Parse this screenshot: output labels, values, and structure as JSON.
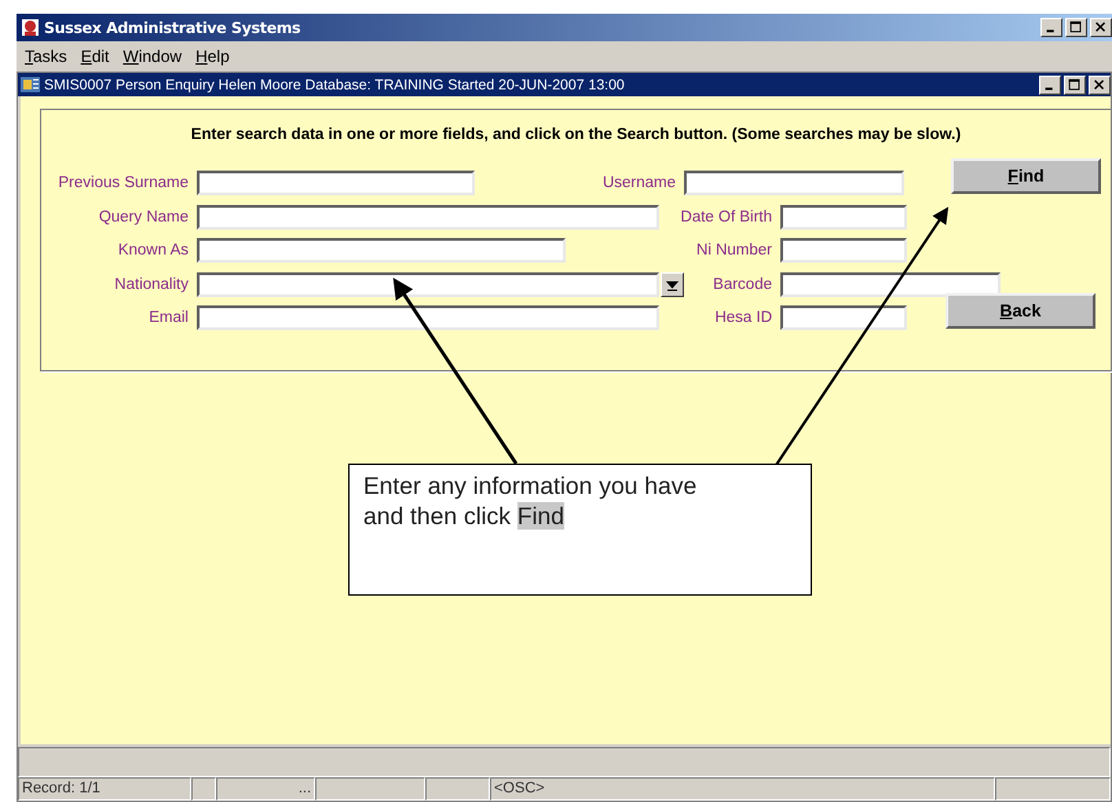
{
  "window": {
    "title": "Sussex Administrative Systems"
  },
  "menu": [
    "Tasks",
    "Edit",
    "Window",
    "Help"
  ],
  "form_window": {
    "title": "SMIS0007  Person Enquiry  Helen Moore Database: TRAINING  Started 20-JUN-2007 13:00"
  },
  "instruction": "Enter search data in one or more fields, and click on the Search button. (Some searches may be slow.)",
  "rows": [
    {
      "left": {
        "label": "Previous Surname",
        "kind": "text"
      },
      "right": {
        "label": "Username"
      }
    },
    {
      "left": {
        "label": "Query Name",
        "kind": "text"
      },
      "right": {
        "label": "Date Of Birth"
      }
    },
    {
      "left": {
        "label": "Known As",
        "kind": "text"
      },
      "right": {
        "label": "Ni Number"
      }
    },
    {
      "left": {
        "label": "Nationality",
        "kind": "list"
      },
      "right": {
        "label": "Barcode"
      }
    },
    {
      "left": {
        "label": "Email",
        "kind": "text"
      },
      "right": {
        "label": "Hesa ID"
      }
    }
  ],
  "buttons": [
    "Find",
    "Back"
  ],
  "callout": {
    "text": "Enter any information you have and then click",
    "highlight": "Find"
  },
  "status_bar": {
    "record": "Record: 1/1",
    "field_3": "...",
    "field_6": "<OSC>"
  }
}
